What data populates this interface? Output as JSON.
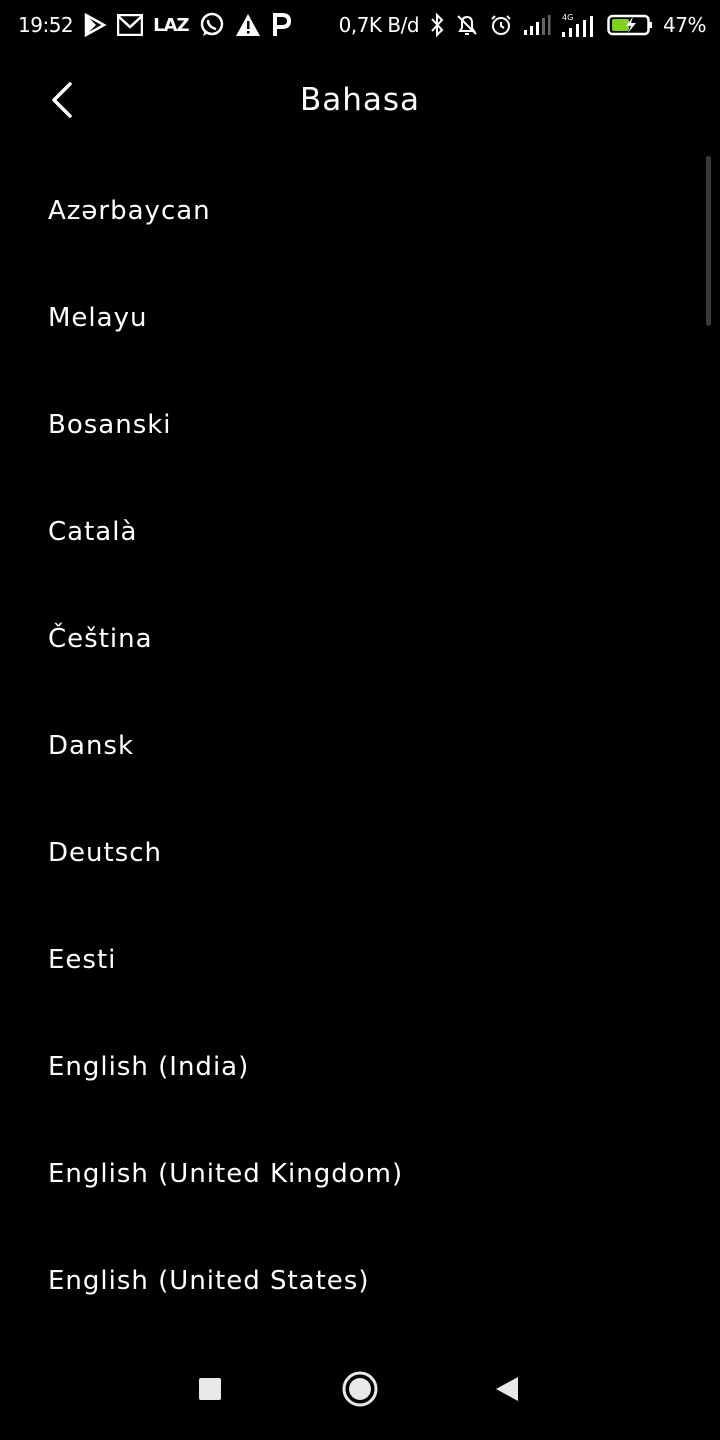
{
  "status_bar": {
    "time": "19:52",
    "net_speed": "0,7K B/d",
    "network_type": "4G",
    "battery": "47%",
    "left_icons": [
      "play-store-icon",
      "gmail-icon",
      "lazada-icon",
      "whatsapp-icon",
      "warning-icon",
      "parking-icon"
    ],
    "right_icons": [
      "bluetooth-icon",
      "notifications-muted-icon",
      "alarm-icon",
      "signal-icon",
      "signal-4g-icon",
      "battery-charging-icon"
    ],
    "lazada_text": "LAZ"
  },
  "header": {
    "title": "Bahasa",
    "back_icon": "chevron-left-icon"
  },
  "languages": [
    "Azərbaycan",
    "Melayu",
    "Bosanski",
    "Català",
    "Čeština",
    "Dansk",
    "Deutsch",
    "Eesti",
    "English (India)",
    "English (United Kingdom)",
    "English (United States)"
  ],
  "nav_bar": {
    "recents_icon": "square-icon",
    "home_icon": "circle-icon",
    "back_icon": "triangle-back-icon"
  },
  "colors": {
    "background": "#000000",
    "text": "#ffffff",
    "battery_accent": "#7ed321"
  }
}
